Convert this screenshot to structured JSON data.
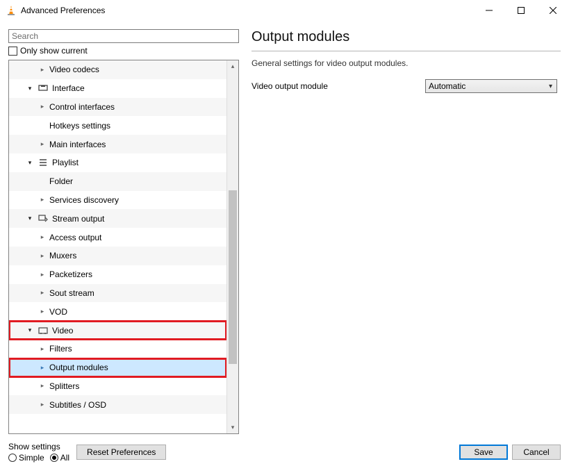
{
  "window": {
    "title": "Advanced Preferences"
  },
  "search": {
    "placeholder": "Search"
  },
  "only_show_current": "Only show current",
  "tree": [
    {
      "label": "Video codecs",
      "depth": 2,
      "expander": "right",
      "icon": "",
      "alt": true
    },
    {
      "label": "Interface",
      "depth": 1,
      "expander": "down",
      "icon": "interface",
      "alt": false
    },
    {
      "label": "Control interfaces",
      "depth": 2,
      "expander": "right",
      "icon": "",
      "alt": true
    },
    {
      "label": "Hotkeys settings",
      "depth": 2,
      "expander": "blank",
      "icon": "",
      "alt": false
    },
    {
      "label": "Main interfaces",
      "depth": 2,
      "expander": "right",
      "icon": "",
      "alt": true
    },
    {
      "label": "Playlist",
      "depth": 1,
      "expander": "down",
      "icon": "playlist",
      "alt": false
    },
    {
      "label": "Folder",
      "depth": 2,
      "expander": "blank",
      "icon": "",
      "alt": true
    },
    {
      "label": "Services discovery",
      "depth": 2,
      "expander": "right",
      "icon": "",
      "alt": false
    },
    {
      "label": "Stream output",
      "depth": 1,
      "expander": "down",
      "icon": "stream",
      "alt": true
    },
    {
      "label": "Access output",
      "depth": 2,
      "expander": "right",
      "icon": "",
      "alt": false
    },
    {
      "label": "Muxers",
      "depth": 2,
      "expander": "right",
      "icon": "",
      "alt": true
    },
    {
      "label": "Packetizers",
      "depth": 2,
      "expander": "right",
      "icon": "",
      "alt": false
    },
    {
      "label": "Sout stream",
      "depth": 2,
      "expander": "right",
      "icon": "",
      "alt": true
    },
    {
      "label": "VOD",
      "depth": 2,
      "expander": "right",
      "icon": "",
      "alt": false
    },
    {
      "label": "Video",
      "depth": 1,
      "expander": "down",
      "icon": "video",
      "alt": true,
      "boxed": true
    },
    {
      "label": "Filters",
      "depth": 2,
      "expander": "right",
      "icon": "",
      "alt": false
    },
    {
      "label": "Output modules",
      "depth": 2,
      "expander": "right-hl",
      "icon": "",
      "alt": true,
      "selected": true,
      "boxed": true
    },
    {
      "label": "Splitters",
      "depth": 2,
      "expander": "right",
      "icon": "",
      "alt": false
    },
    {
      "label": "Subtitles / OSD",
      "depth": 2,
      "expander": "right",
      "icon": "",
      "alt": true
    }
  ],
  "page": {
    "title": "Output modules",
    "description": "General settings for video output modules.",
    "field_label": "Video output module",
    "field_value": "Automatic"
  },
  "footer": {
    "show_settings_label": "Show settings",
    "simple": "Simple",
    "all": "All",
    "reset": "Reset Preferences",
    "save": "Save",
    "cancel": "Cancel"
  }
}
